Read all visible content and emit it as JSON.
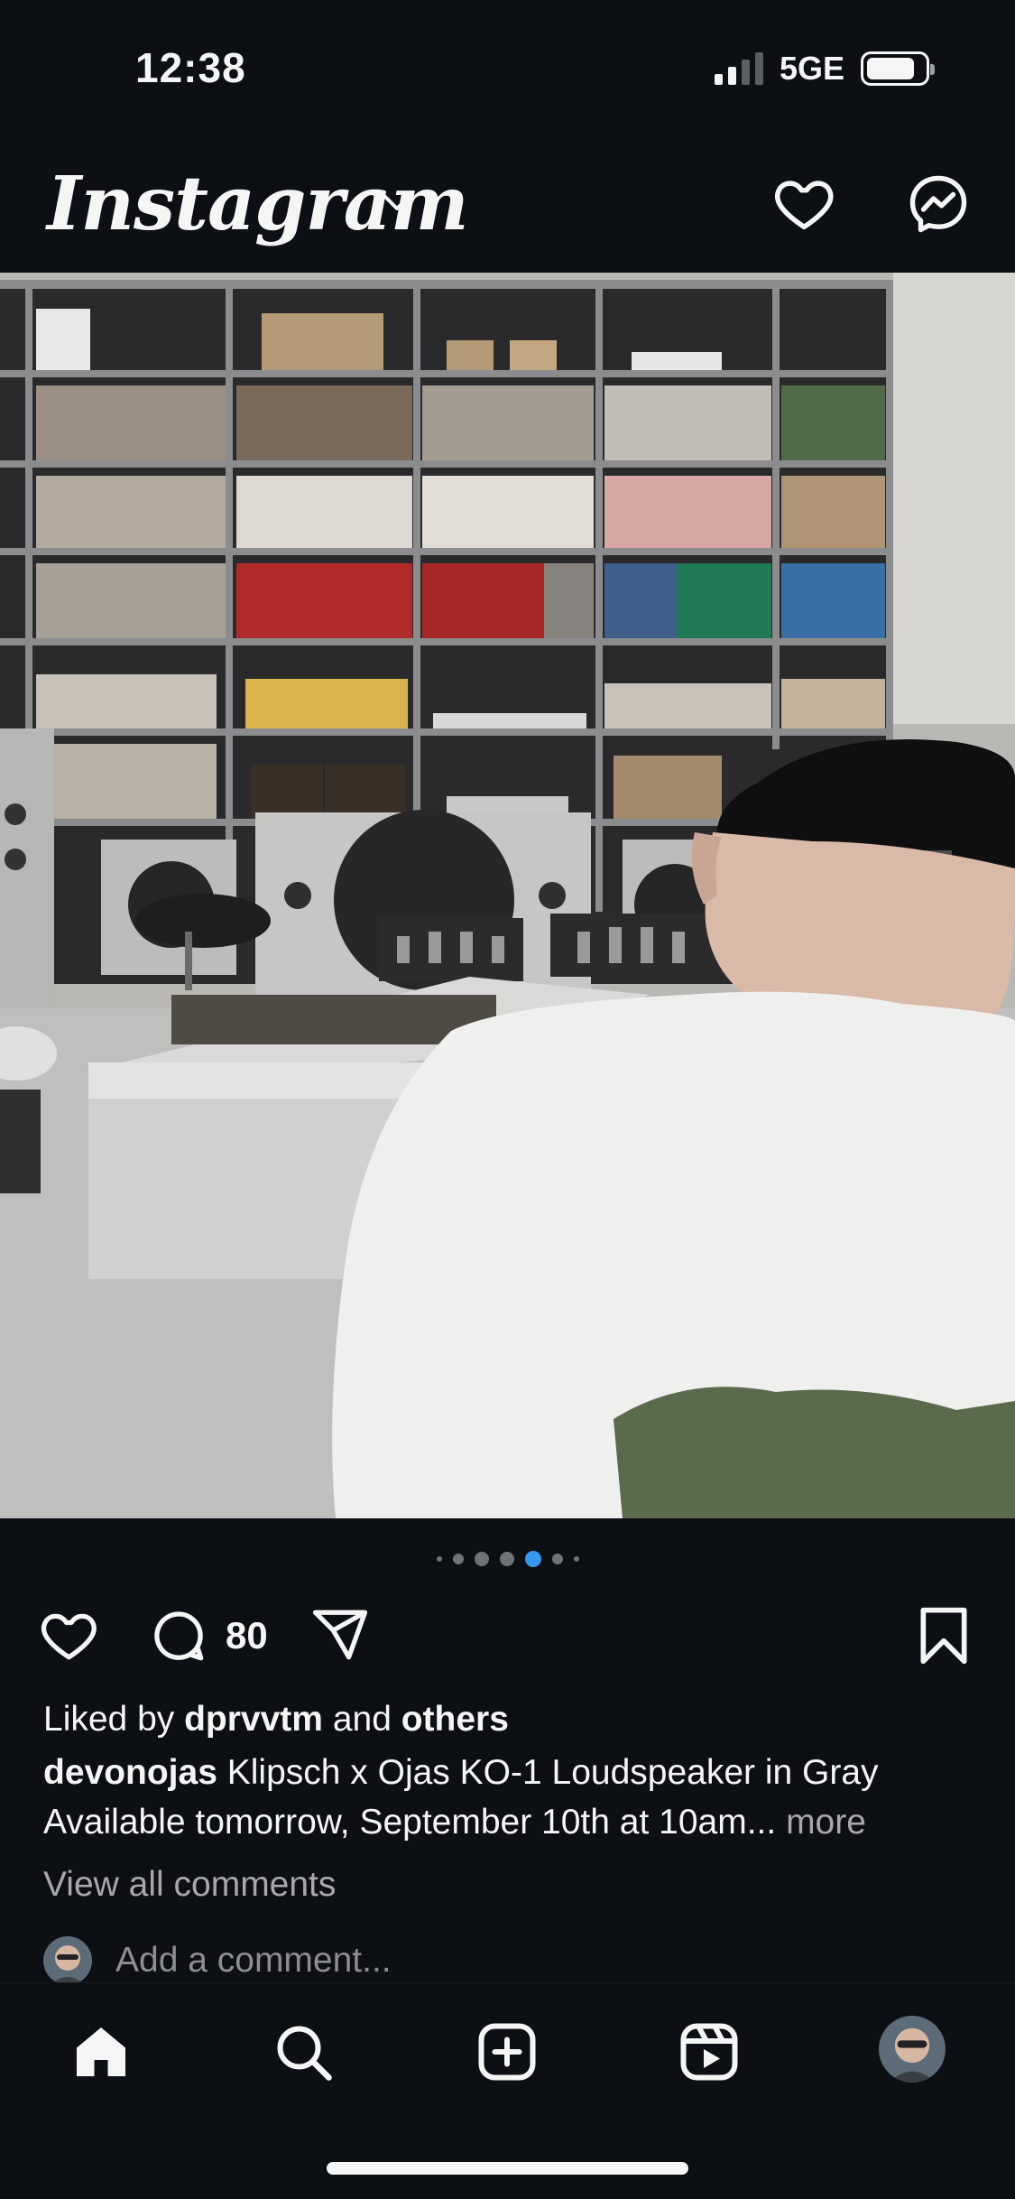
{
  "status_bar": {
    "time": "12:38",
    "network": "5GE"
  },
  "header": {
    "logo_text": "Instagram",
    "icons": [
      "chevron-down-icon",
      "heart-icon",
      "messenger-icon"
    ]
  },
  "post": {
    "carousel": {
      "total": 7,
      "active_index": 4
    },
    "comment_count": "80",
    "liked_by": {
      "prefix": "Liked by ",
      "user": "dprvvtm",
      "middle": " and ",
      "others": "others"
    },
    "caption": {
      "username": "devonojas",
      "text_line1": " Klipsch x Ojas KO-1 Loudspeaker in Gray",
      "text_line2": "Available tomorrow, September 10th at 10am...",
      "more": " more"
    },
    "view_comments": "View all comments",
    "add_comment_placeholder": "Add a comment..."
  },
  "tabbar": {
    "tabs": [
      "home-icon",
      "search-icon",
      "create-icon",
      "reels-icon",
      "profile-avatar"
    ]
  },
  "colors": {
    "background": "#0c1014",
    "text": "#f5f5f5",
    "muted": "#a8a8a8",
    "active_dot": "#3897f0"
  }
}
